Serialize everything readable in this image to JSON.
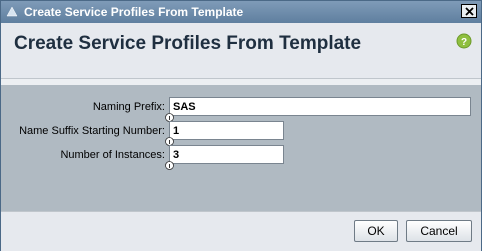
{
  "window": {
    "title": "Create Service Profiles From Template"
  },
  "header": {
    "heading": "Create Service Profiles From Template"
  },
  "form": {
    "naming_prefix": {
      "label": "Naming Prefix:",
      "value": "SAS"
    },
    "suffix_start": {
      "label": "Name Suffix Starting Number:",
      "value": "1"
    },
    "instances": {
      "label": "Number of Instances:",
      "value": "3"
    }
  },
  "footer": {
    "ok_label": "OK",
    "cancel_label": "Cancel"
  }
}
